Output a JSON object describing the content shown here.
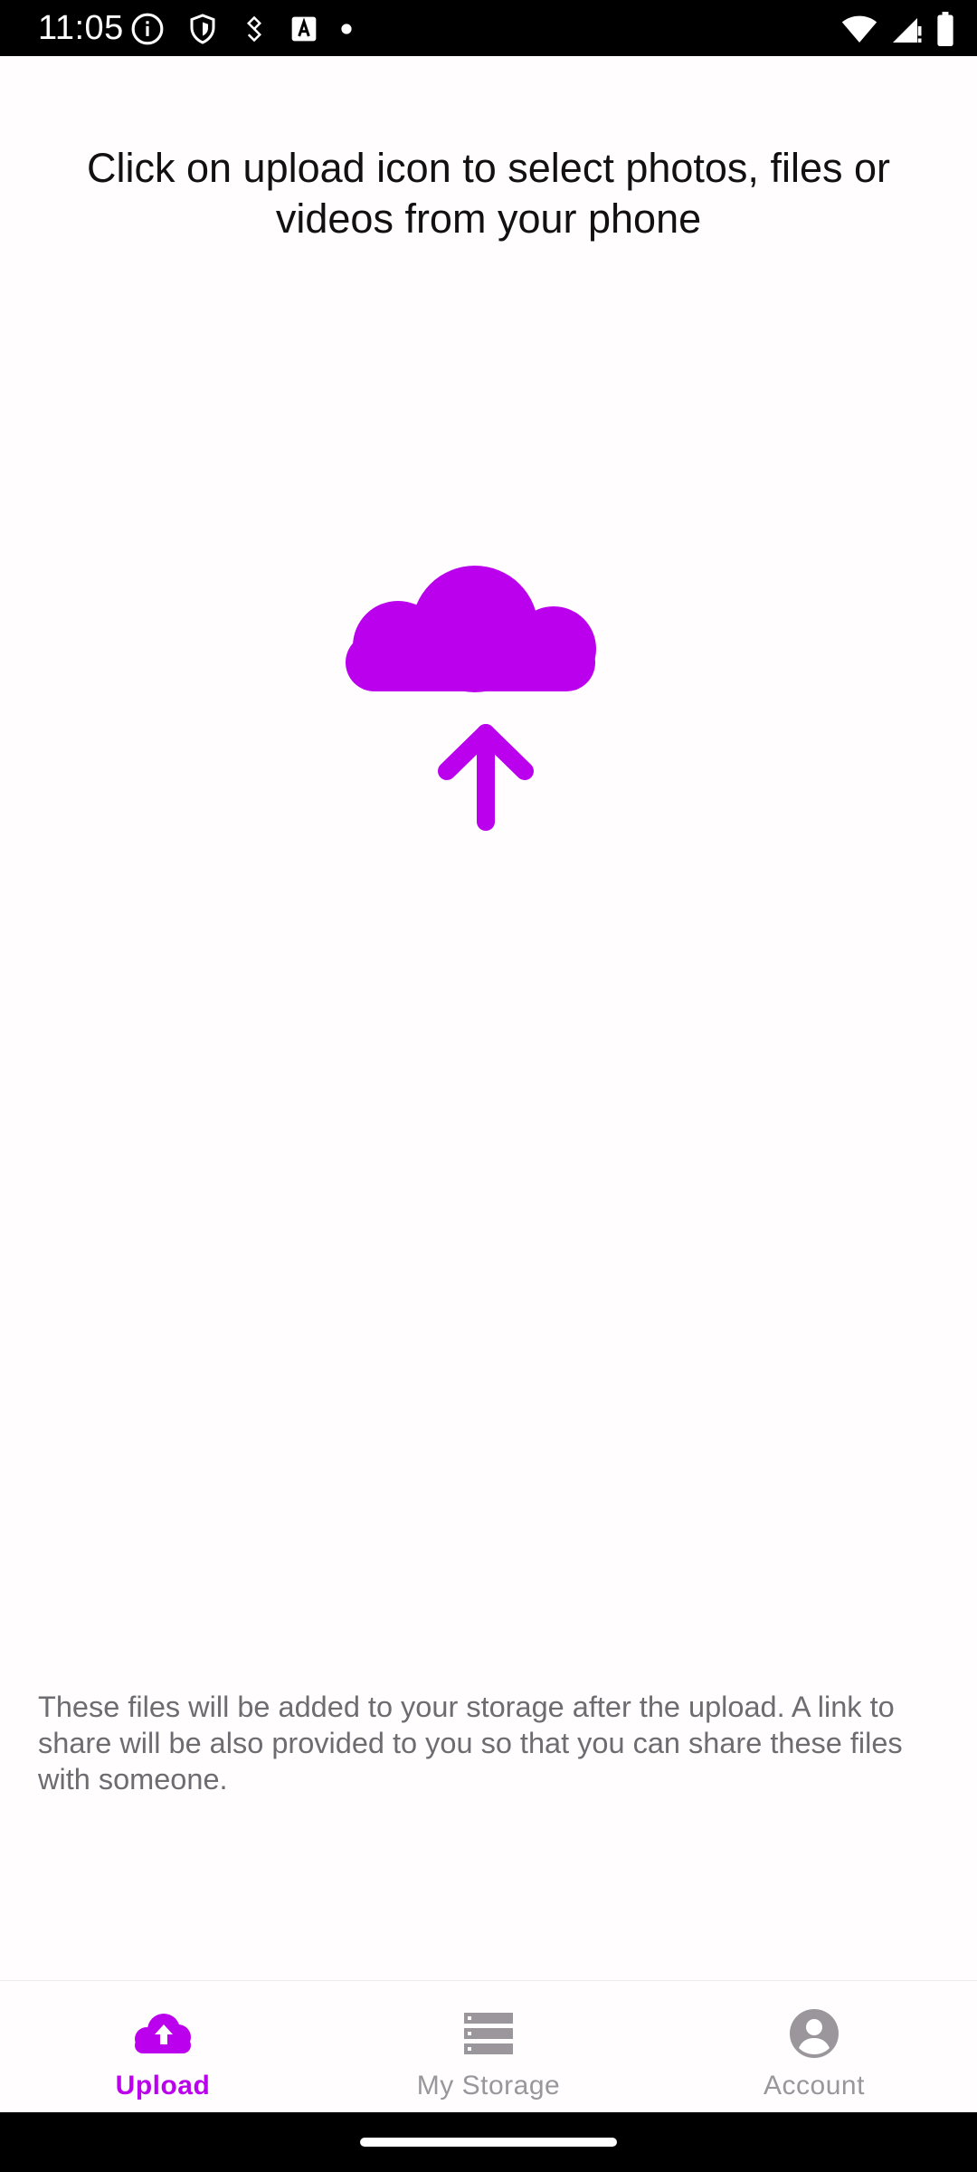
{
  "status_bar": {
    "time": "11:05",
    "left_icons": [
      "info-icon",
      "shield-icon",
      "stairs-icon",
      "keyboard-a-icon",
      "dot-icon"
    ],
    "right_icons": [
      "wifi-icon",
      "signal-icon",
      "battery-icon"
    ]
  },
  "main": {
    "instruction": "Click on upload icon to select photos, files or videos from your phone",
    "hero_icon": "cloud-upload-icon",
    "footnote": "These files will be added to your storage after the upload. A link to share will be also provided to you so that you can share these files with someone."
  },
  "bottom_nav": {
    "items": [
      {
        "label": "Upload",
        "icon": "cloud-upload-icon",
        "active": true
      },
      {
        "label": "My Storage",
        "icon": "storage-icon",
        "active": false
      },
      {
        "label": "Account",
        "icon": "account-icon",
        "active": false
      }
    ]
  },
  "colors": {
    "accent": "#bb00ee",
    "inactive": "#9a969b",
    "background": "#fffdfe",
    "text_primary": "#111111",
    "text_secondary": "#6f6b70"
  }
}
